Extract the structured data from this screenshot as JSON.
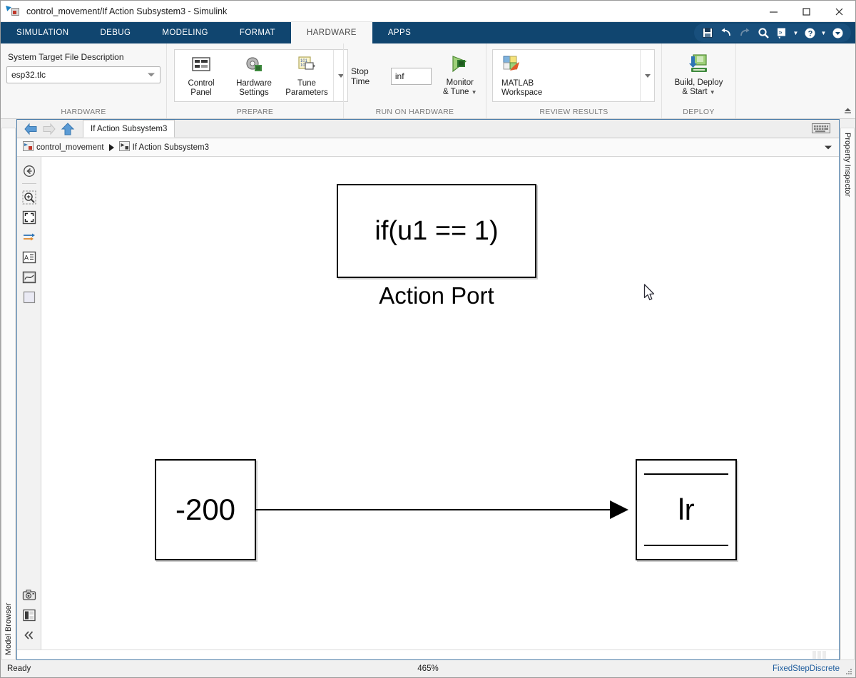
{
  "window": {
    "title": "control_movement/If Action Subsystem3 - Simulink",
    "icon": "simulink-model-icon",
    "minimize": "minimize-icon",
    "maximize": "maximize-icon",
    "close": "close-icon"
  },
  "ribbon": {
    "tabs": [
      {
        "label": "SIMULATION",
        "active": false
      },
      {
        "label": "DEBUG",
        "active": false
      },
      {
        "label": "MODELING",
        "active": false
      },
      {
        "label": "FORMAT",
        "active": false
      },
      {
        "label": "HARDWARE",
        "active": true
      },
      {
        "label": "APPS",
        "active": false
      }
    ],
    "quick_access": [
      {
        "name": "save-icon"
      },
      {
        "name": "undo-icon"
      },
      {
        "name": "redo-icon"
      },
      {
        "name": "search-icon"
      },
      {
        "name": "favorites-icon"
      },
      {
        "name": "help-icon"
      },
      {
        "name": "customize-icon"
      }
    ],
    "groups": [
      {
        "label": "HARDWARE",
        "field_label": "System Target File Description",
        "combo_value": "esp32.tlc"
      },
      {
        "label": "PREPARE",
        "buttons": [
          {
            "line1": "Control",
            "line2": "Panel",
            "icon": "control-panel-icon"
          },
          {
            "line1": "Hardware",
            "line2": "Settings",
            "icon": "hardware-settings-icon"
          },
          {
            "line1": "Tune",
            "line2": "Parameters",
            "icon": "tune-parameters-icon"
          }
        ]
      },
      {
        "label": "RUN ON HARDWARE",
        "stop_time_label": "Stop Time",
        "stop_time_value": "inf",
        "monitor": {
          "line1": "Monitor",
          "line2": "& Tune",
          "icon": "monitor-tune-icon"
        }
      },
      {
        "label": "REVIEW RESULTS",
        "buttons": [
          {
            "line1": "MATLAB",
            "line2": "Workspace",
            "icon": "matlab-workspace-icon"
          }
        ]
      },
      {
        "label": "DEPLOY",
        "buttons": [
          {
            "line1": "Build, Deploy",
            "line2": "& Start",
            "icon": "build-deploy-start-icon"
          }
        ]
      }
    ]
  },
  "panels": {
    "left_label": "Model Browser",
    "right_label": "Property Inspector"
  },
  "editor": {
    "nav": {
      "back": "back-arrow-icon",
      "forward": "forward-arrow-icon",
      "up": "up-arrow-icon"
    },
    "document_tab": "If Action Subsystem3",
    "keyboard_icon": "keyboard-icon",
    "breadcrumb": [
      {
        "label": "control_movement",
        "icon": "model-icon"
      },
      {
        "label": "If Action Subsystem3",
        "icon": "subsystem-icon"
      }
    ],
    "tools": [
      {
        "name": "navigate-up-icon"
      },
      {
        "name": "zoom-region-icon"
      },
      {
        "name": "fit-to-view-icon"
      },
      {
        "name": "signal-lines-icon"
      },
      {
        "name": "annotation-icon"
      },
      {
        "name": "scope-viewer-icon"
      },
      {
        "name": "area-icon"
      }
    ],
    "tools_bottom": [
      {
        "name": "camera-snapshot-icon"
      },
      {
        "name": "layout-icon"
      },
      {
        "name": "collapse-toolbar-icon"
      }
    ]
  },
  "diagram": {
    "if_block_text": "if(u1 == 1)",
    "action_port_label": "Action Port",
    "constant_value": "-200",
    "goto_tag": "lr",
    "cursor": "mouse-pointer"
  },
  "statusbar": {
    "ready": "Ready",
    "zoom": "465%",
    "solver": "FixedStepDiscrete"
  },
  "colors": {
    "ribbon_blue": "#10456f",
    "accent_link": "#1f5d9e",
    "editor_border": "#4a7ba7"
  }
}
